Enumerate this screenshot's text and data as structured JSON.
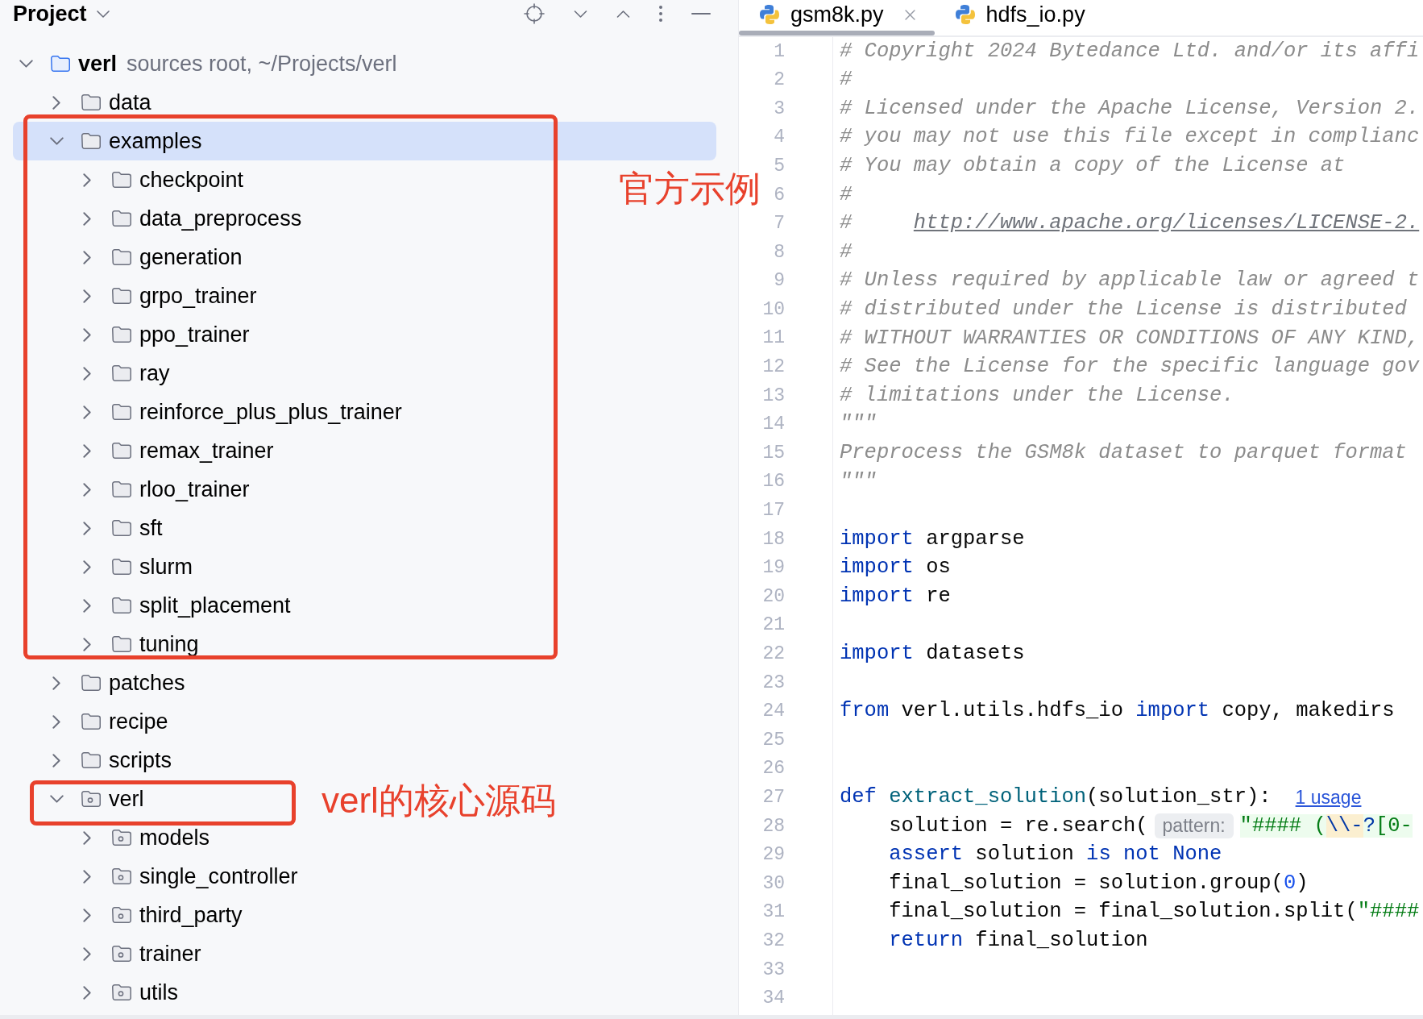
{
  "panel": {
    "title": "Project"
  },
  "project_tree": [
    {
      "label": "verl",
      "note": "sources root, ~/Projects/verl",
      "kind": "source_root",
      "expanded": true,
      "selected": false,
      "children": [
        {
          "label": "data",
          "kind": "folder",
          "expanded": false,
          "selected": false
        },
        {
          "label": "examples",
          "kind": "folder",
          "expanded": true,
          "selected": true,
          "children": [
            {
              "label": "checkpoint",
              "kind": "folder",
              "expanded": false,
              "selected": false
            },
            {
              "label": "data_preprocess",
              "kind": "folder",
              "expanded": false,
              "selected": false
            },
            {
              "label": "generation",
              "kind": "folder",
              "expanded": false,
              "selected": false
            },
            {
              "label": "grpo_trainer",
              "kind": "folder",
              "expanded": false,
              "selected": false
            },
            {
              "label": "ppo_trainer",
              "kind": "folder",
              "expanded": false,
              "selected": false
            },
            {
              "label": "ray",
              "kind": "folder",
              "expanded": false,
              "selected": false
            },
            {
              "label": "reinforce_plus_plus_trainer",
              "kind": "folder",
              "expanded": false,
              "selected": false
            },
            {
              "label": "remax_trainer",
              "kind": "folder",
              "expanded": false,
              "selected": false
            },
            {
              "label": "rloo_trainer",
              "kind": "folder",
              "expanded": false,
              "selected": false
            },
            {
              "label": "sft",
              "kind": "folder",
              "expanded": false,
              "selected": false
            },
            {
              "label": "slurm",
              "kind": "folder",
              "expanded": false,
              "selected": false
            },
            {
              "label": "split_placement",
              "kind": "folder",
              "expanded": false,
              "selected": false
            },
            {
              "label": "tuning",
              "kind": "folder",
              "expanded": false,
              "selected": false
            }
          ]
        },
        {
          "label": "patches",
          "kind": "folder",
          "expanded": false,
          "selected": false
        },
        {
          "label": "recipe",
          "kind": "folder",
          "expanded": false,
          "selected": false
        },
        {
          "label": "scripts",
          "kind": "folder",
          "expanded": false,
          "selected": false
        },
        {
          "label": "verl",
          "kind": "package",
          "expanded": true,
          "selected": false,
          "children": [
            {
              "label": "models",
              "kind": "package",
              "expanded": false,
              "selected": false
            },
            {
              "label": "single_controller",
              "kind": "package",
              "expanded": false,
              "selected": false
            },
            {
              "label": "third_party",
              "kind": "package",
              "expanded": false,
              "selected": false
            },
            {
              "label": "trainer",
              "kind": "package",
              "expanded": false,
              "selected": false
            },
            {
              "label": "utils",
              "kind": "package",
              "expanded": false,
              "selected": false
            }
          ]
        }
      ]
    }
  ],
  "editor": {
    "tabs": [
      {
        "name": "gsm8k.py",
        "selected": true
      },
      {
        "name": "hdfs_io.py",
        "selected": false
      }
    ],
    "lines": [
      {
        "number": "1",
        "tokens": [
          {
            "kind": "comment",
            "text": "# Copyright 2024 Bytedance Ltd. and/or its affi"
          }
        ]
      },
      {
        "number": "2",
        "tokens": [
          {
            "kind": "comment",
            "text": "#"
          }
        ]
      },
      {
        "number": "3",
        "tokens": [
          {
            "kind": "comment",
            "text": "# Licensed under the Apache License, Version 2."
          }
        ]
      },
      {
        "number": "4",
        "tokens": [
          {
            "kind": "comment",
            "text": "# you may not use this file except in complianc"
          }
        ]
      },
      {
        "number": "5",
        "tokens": [
          {
            "kind": "comment",
            "text": "# You may obtain a copy of the License at"
          }
        ]
      },
      {
        "number": "6",
        "tokens": [
          {
            "kind": "comment",
            "text": "#"
          }
        ]
      },
      {
        "number": "7",
        "tokens": [
          {
            "kind": "comment",
            "text": "#     "
          },
          {
            "kind": "link",
            "text": "http://www.apache.org/licenses/LICENSE-2."
          }
        ]
      },
      {
        "number": "8",
        "tokens": [
          {
            "kind": "comment",
            "text": "#"
          }
        ]
      },
      {
        "number": "9",
        "tokens": [
          {
            "kind": "comment",
            "text": "# Unless required by applicable law or agreed t"
          }
        ]
      },
      {
        "number": "10",
        "tokens": [
          {
            "kind": "comment",
            "text": "# distributed under the License is distributed"
          }
        ]
      },
      {
        "number": "11",
        "tokens": [
          {
            "kind": "comment",
            "text": "# WITHOUT WARRANTIES OR CONDITIONS OF ANY KIND,"
          }
        ]
      },
      {
        "number": "12",
        "tokens": [
          {
            "kind": "comment",
            "text": "# See the License for the specific language gov"
          }
        ]
      },
      {
        "number": "13",
        "tokens": [
          {
            "kind": "comment",
            "text": "# limitations under the License."
          }
        ]
      },
      {
        "number": "14",
        "tokens": [
          {
            "kind": "doc",
            "text": "\"\"\""
          }
        ]
      },
      {
        "number": "15",
        "tokens": [
          {
            "kind": "doc",
            "text": "Preprocess the GSM8k dataset to parquet format"
          }
        ]
      },
      {
        "number": "16",
        "tokens": [
          {
            "kind": "doc",
            "text": "\"\"\""
          }
        ]
      },
      {
        "number": "17"
      },
      {
        "number": "18",
        "tokens": [
          {
            "kind": "keyword",
            "text": "import"
          },
          {
            "kind": "plain",
            "text": " argparse"
          }
        ]
      },
      {
        "number": "19",
        "tokens": [
          {
            "kind": "keyword",
            "text": "import"
          },
          {
            "kind": "plain",
            "text": " os"
          }
        ]
      },
      {
        "number": "20",
        "tokens": [
          {
            "kind": "keyword",
            "text": "import"
          },
          {
            "kind": "plain",
            "text": " re"
          }
        ]
      },
      {
        "number": "21"
      },
      {
        "number": "22",
        "tokens": [
          {
            "kind": "keyword",
            "text": "import"
          },
          {
            "kind": "plain",
            "text": " datasets"
          }
        ]
      },
      {
        "number": "23"
      },
      {
        "number": "24",
        "tokens": [
          {
            "kind": "keyword",
            "text": "from"
          },
          {
            "kind": "plain",
            "text": " verl.utils.hdfs_io "
          },
          {
            "kind": "keyword",
            "text": "import"
          },
          {
            "kind": "plain",
            "text": " copy, makedirs"
          }
        ]
      },
      {
        "number": "25"
      },
      {
        "number": "26"
      },
      {
        "number": "27",
        "tokens": [
          {
            "kind": "keyword",
            "text": "def "
          },
          {
            "kind": "func",
            "text": "extract_solution"
          },
          {
            "kind": "plain",
            "text": "(solution_str):"
          },
          {
            "kind": "usage",
            "text": "1 usage"
          }
        ]
      },
      {
        "number": "28",
        "tokens": [
          {
            "kind": "plain",
            "text": "    solution = re.search("
          },
          {
            "kind": "hint",
            "text": "pattern:"
          },
          {
            "kind": "regex",
            "text": "\"#### ("
          },
          {
            "kind": "regex_escape",
            "text": "\\\\-"
          },
          {
            "kind": "regex_op",
            "text": "?"
          },
          {
            "kind": "regex",
            "text": "[0-"
          }
        ]
      },
      {
        "number": "29",
        "tokens": [
          {
            "kind": "keyword",
            "text": "    assert"
          },
          {
            "kind": "plain",
            "text": " solution "
          },
          {
            "kind": "keyword",
            "text": "is not None"
          }
        ]
      },
      {
        "number": "30",
        "tokens": [
          {
            "kind": "plain",
            "text": "    final_solution = solution.group("
          },
          {
            "kind": "number",
            "text": "0"
          },
          {
            "kind": "plain",
            "text": ")"
          }
        ]
      },
      {
        "number": "31",
        "tokens": [
          {
            "kind": "plain",
            "text": "    final_solution = final_solution.split("
          },
          {
            "kind": "string",
            "text": "\"####"
          }
        ]
      },
      {
        "number": "32",
        "tokens": [
          {
            "kind": "keyword",
            "text": "    return"
          },
          {
            "kind": "plain",
            "text": " final_solution"
          }
        ]
      },
      {
        "number": "33"
      },
      {
        "number": "34"
      }
    ]
  },
  "annotations": [
    {
      "label": "官方示例"
    },
    {
      "label": "verl的核心源码"
    }
  ]
}
